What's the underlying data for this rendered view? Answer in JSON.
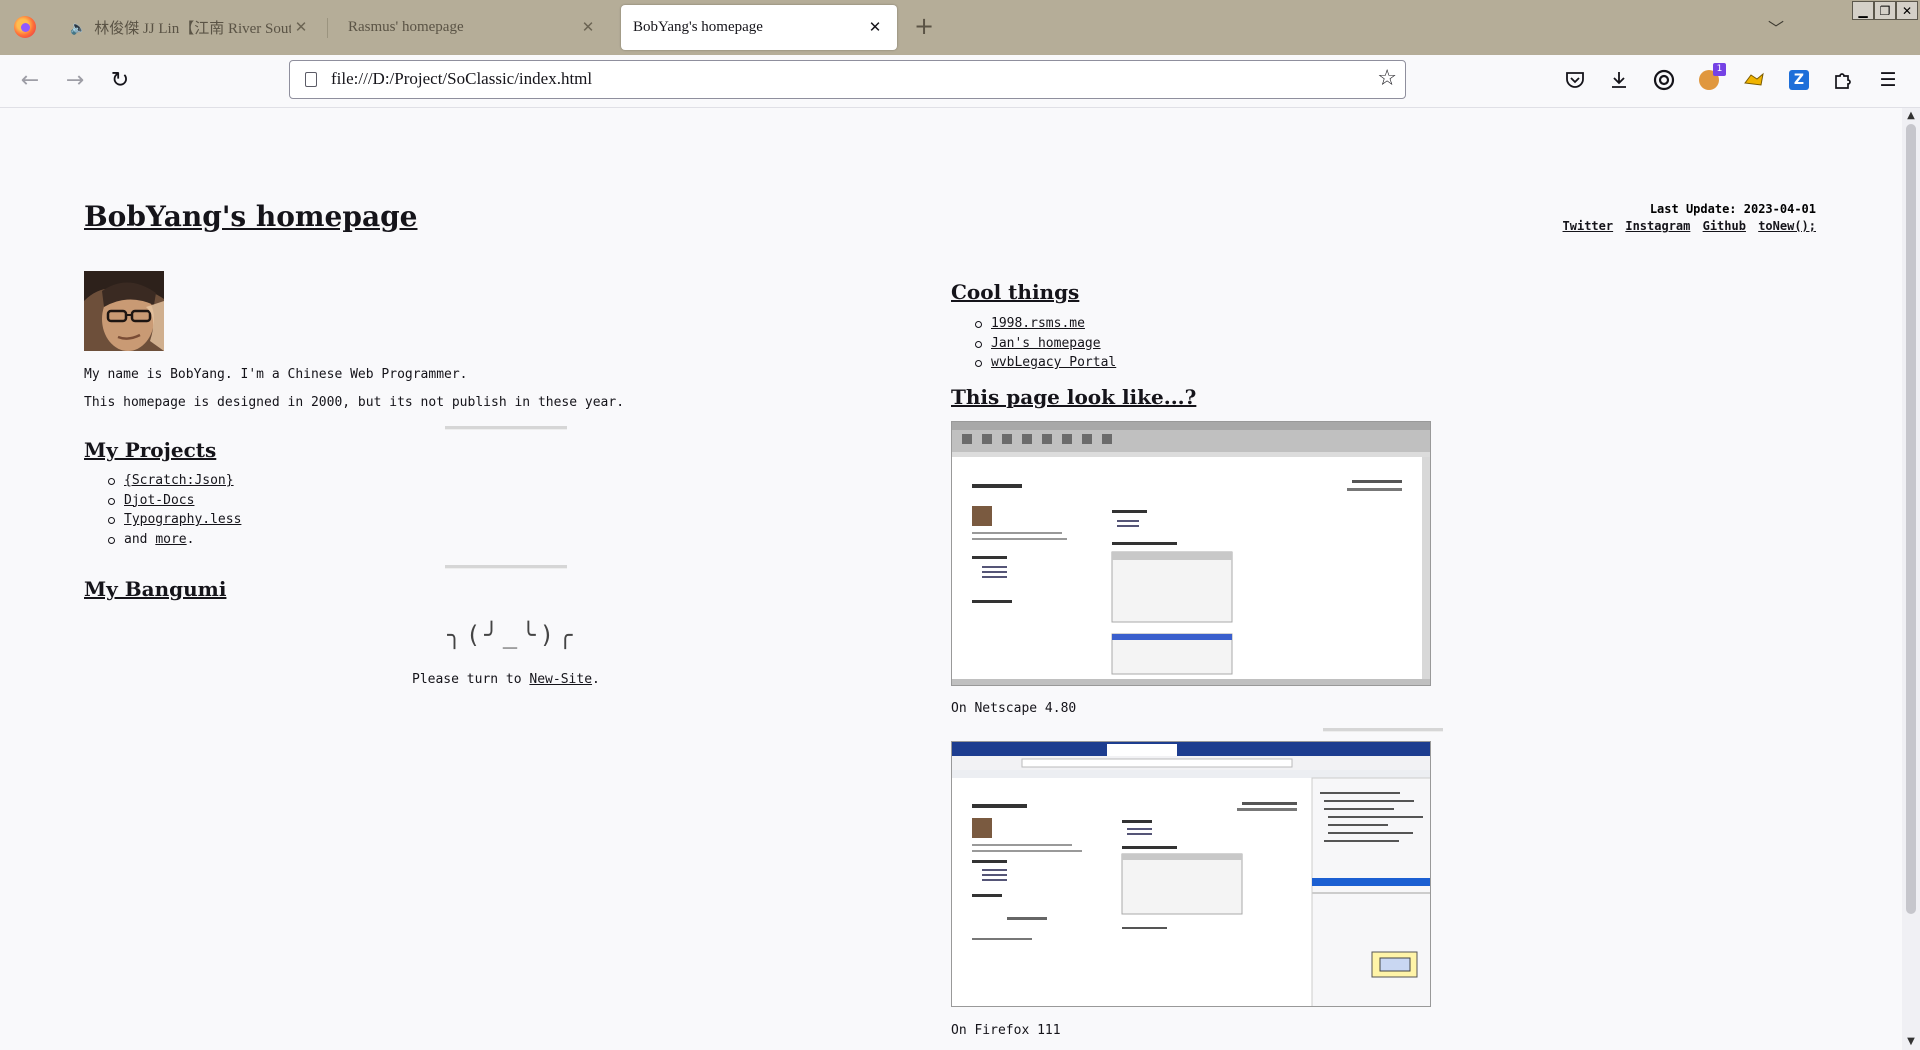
{
  "browser": {
    "tabs": [
      {
        "title": "林俊傑 JJ Lin【江南 River South】",
        "audio": true,
        "active": false
      },
      {
        "title": "Rasmus' homepage",
        "audio": false,
        "active": false
      },
      {
        "title": "BobYang's homepage",
        "audio": false,
        "active": true
      }
    ],
    "url": "file:///D:/Project/SoClassic/index.html",
    "extension_badge": "1",
    "accent": "#7542e5",
    "tabbar_color": "#b5ad98"
  },
  "page": {
    "title": "BobYang's homepage",
    "last_update": "Last Update: 2023-04-01",
    "social_links": [
      "Twitter",
      "Instagram",
      "Github",
      "toNew();"
    ],
    "intro": [
      "My name is BobYang. I'm a Chinese Web Programmer.",
      "This homepage is designed in 2000, but its not publish in these year."
    ],
    "projects": {
      "heading": "My Projects",
      "items": [
        "{Scratch:Json}",
        "Djot-Docs",
        "Typography.less"
      ],
      "more_prefix": "and ",
      "more_link": "more",
      "more_suffix": "."
    },
    "bangumi": {
      "heading": "My Bangumi"
    },
    "shrug": "╮(╯_╰)╭",
    "turn_prefix": "Please turn to ",
    "turn_link": "New-Site",
    "turn_suffix": ".",
    "cool": {
      "heading": "Cool things",
      "items": [
        "1998.rsms.me",
        "Jan's homepage",
        "wvbLegacy Portal"
      ]
    },
    "look": {
      "heading": "This page look like...?",
      "captions": [
        "On Netscape 4.80",
        "On Firefox 111"
      ]
    }
  }
}
